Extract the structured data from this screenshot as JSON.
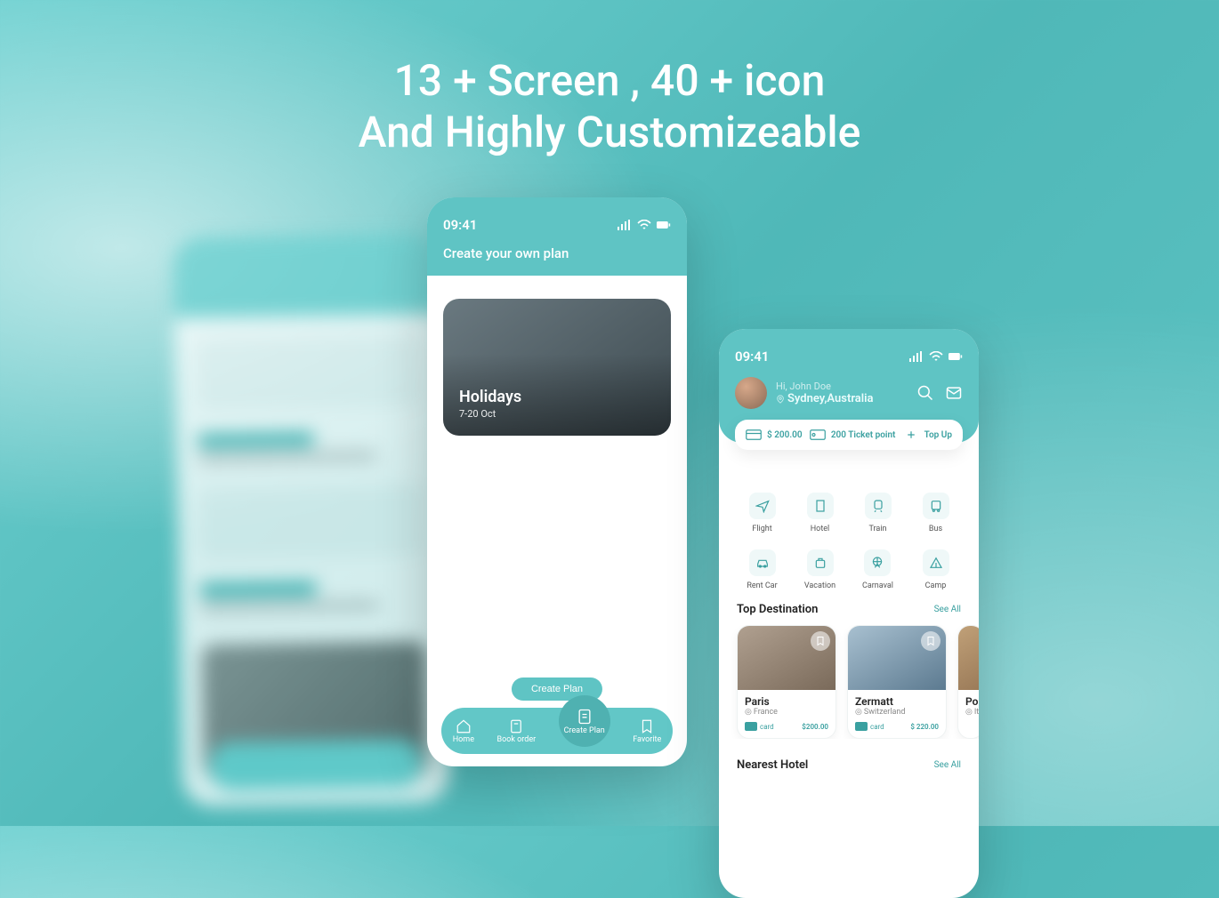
{
  "hero": {
    "line1": "13 + Screen , 40 + icon",
    "line2": "And Highly Customizeable"
  },
  "statusTime": "09:41",
  "center": {
    "title": "Create your own plan",
    "planCard": {
      "name": "Holidays",
      "dates": "7-20 Oct"
    },
    "createButton": "Create Plan",
    "nav": [
      {
        "label": "Home"
      },
      {
        "label": "Book order"
      },
      {
        "label": "Create Plan"
      },
      {
        "label": "Favorite"
      }
    ]
  },
  "right": {
    "greeting": "Hi, John Doe",
    "location": "Sydney,Australia",
    "wallet": {
      "balance": "$ 200.00",
      "points": "200 Ticket point",
      "topup": "Top Up"
    },
    "categories": [
      "Flight",
      "Hotel",
      "Train",
      "Bus",
      "Rent Car",
      "Vacation",
      "Carnaval",
      "Camp"
    ],
    "topDest": {
      "title": "Top Destination",
      "seeAll": "See All",
      "items": [
        {
          "name": "Paris",
          "country": "France",
          "price": "$200.00"
        },
        {
          "name": "Zermatt",
          "country": "Switzerland",
          "price": "$ 220.00"
        },
        {
          "name": "Po",
          "country": "It"
        }
      ]
    },
    "nearest": {
      "title": "Nearest Hotel",
      "seeAll": "See All"
    }
  }
}
